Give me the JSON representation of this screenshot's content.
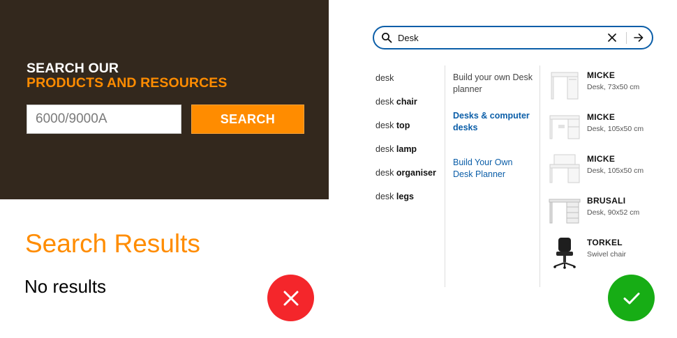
{
  "left_example": {
    "heading_line1": "SEARCH OUR",
    "heading_line2": "PRODUCTS AND RESOURCES",
    "search_value": "6000/9000A",
    "search_button": "SEARCH",
    "results_title": "Search Results",
    "results_text": "No results",
    "status_icon": "close-icon",
    "status_color": "#f4262b"
  },
  "right_example": {
    "search_value": "Desk",
    "icons": [
      "search-icon",
      "clear-icon",
      "arrow-right-icon"
    ],
    "suggestions": [
      {
        "prefix": "desk",
        "bold": ""
      },
      {
        "prefix": "desk ",
        "bold": "chair"
      },
      {
        "prefix": "desk ",
        "bold": "top"
      },
      {
        "prefix": "desk ",
        "bold": "lamp"
      },
      {
        "prefix": "desk ",
        "bold": "organiser"
      },
      {
        "prefix": "desk ",
        "bold": "legs"
      }
    ],
    "links": [
      "Build your own Desk planner",
      "Desks & computer desks",
      "Build Your Own Desk Planner"
    ],
    "products": [
      {
        "name": "MICKE",
        "desc": "Desk, 73x50 cm"
      },
      {
        "name": "MICKE",
        "desc": "Desk, 105x50 cm"
      },
      {
        "name": "MICKE",
        "desc": "Desk, 105x50 cm"
      },
      {
        "name": "BRUSALI",
        "desc": "Desk, 90x52 cm"
      },
      {
        "name": "TORKEL",
        "desc": "Swivel chair"
      }
    ],
    "status_icon": "check-icon",
    "status_color": "#17ad15"
  },
  "colors": {
    "brand_dark": "#33281d",
    "accent_orange": "#ff8c00",
    "link_blue": "#0b5ea8"
  }
}
